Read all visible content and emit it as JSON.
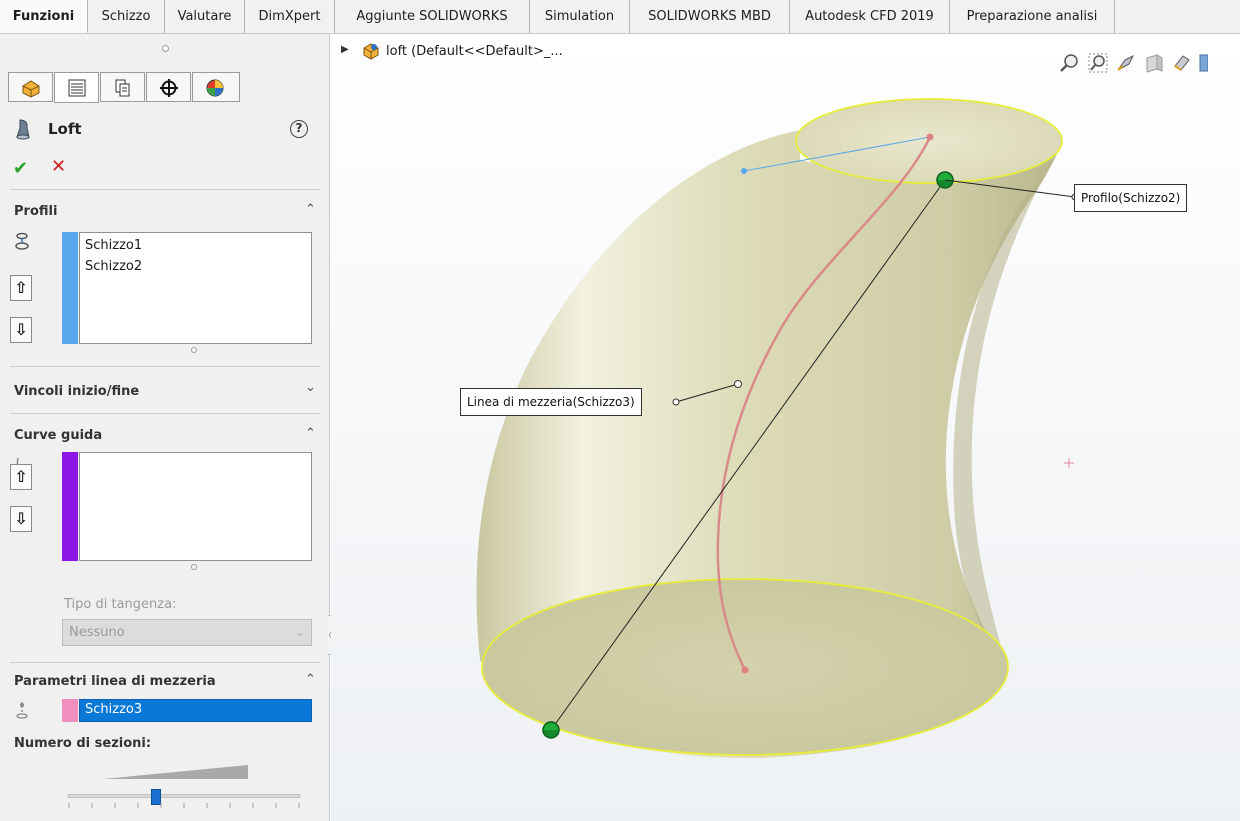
{
  "tabs": [
    "Funzioni",
    "Schizzo",
    "Valutare",
    "DimXpert",
    "Aggiunte SOLIDWORKS",
    "Simulation",
    "SOLIDWORKS MBD",
    "Autodesk CFD 2019",
    "Preparazione analisi"
  ],
  "manager_tabs": [
    "feature-manager",
    "property-manager",
    "configuration-manager",
    "dimxpert-manager",
    "display-manager"
  ],
  "property_manager": {
    "title": "Loft",
    "help": "?",
    "ok": "✔",
    "cancel": "✕",
    "profiles": {
      "header": "Profili",
      "items": [
        "Schizzo1",
        "Schizzo2"
      ],
      "bar_color": "#5aa7ee"
    },
    "constraints": {
      "header": "Vincoli inizio/fine"
    },
    "guide_curves": {
      "header": "Curve guida",
      "items": [],
      "bar_color": "#8a17e6",
      "tangency_label": "Tipo di tangenza:",
      "tangency_value": "Nessuno"
    },
    "centerline": {
      "header": "Parametri linea di mezzeria",
      "value": "Schizzo3",
      "swatch_color": "#f08fbe",
      "sections_label": "Numero di sezioni:"
    }
  },
  "viewport": {
    "tree_label": "loft  (Default<<Default>_...",
    "callouts": {
      "profile": "Profilo(Schizzo2)",
      "centerline": "Linea di mezzeria(Schizzo3)"
    },
    "colors": {
      "body": "#e4e4c4",
      "profile_outline": "#e8ec3a",
      "centerline_curve": "#d98a8a",
      "handle": "#1fae3a"
    }
  }
}
